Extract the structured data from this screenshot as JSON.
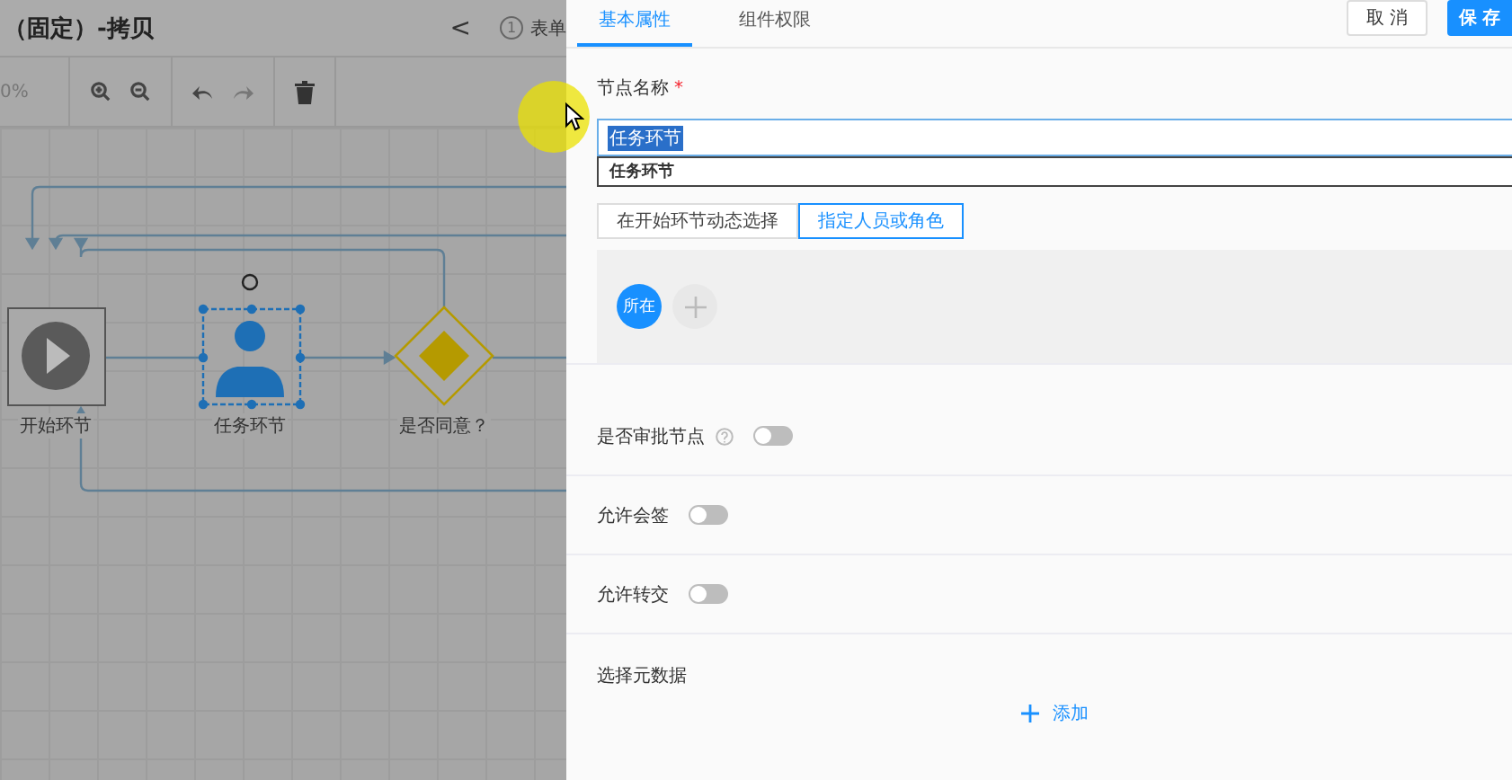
{
  "designer": {
    "title": "（固定）-拷贝",
    "back": "<",
    "step": {
      "number": "1",
      "label": "表单"
    },
    "zoom": "0%",
    "nodes": [
      {
        "kind": "start",
        "label": "开始环节",
        "selected": false
      },
      {
        "kind": "task",
        "label": "任务环节",
        "selected": true
      },
      {
        "kind": "gateway",
        "label": "是否同意？",
        "selected": false
      }
    ]
  },
  "panel": {
    "tabs": [
      {
        "label": "基本属性",
        "selected": true
      },
      {
        "label": "组件权限",
        "selected": false
      }
    ],
    "buttons": [
      {
        "label": "取 消",
        "kind": "default"
      },
      {
        "label": "保 存",
        "kind": "primary"
      }
    ],
    "name_field": {
      "label": "节点名称",
      "required_mark": "*",
      "value": "任务环节",
      "suggestion": "任务环节"
    },
    "assign_options": [
      {
        "label": "在开始环节动态选择",
        "selected": false
      },
      {
        "label": "指定人员或角色",
        "selected": true
      }
    ],
    "members": [
      {
        "label": "所在"
      }
    ],
    "switches": [
      {
        "label": "是否审批节点",
        "help": true,
        "on": false
      },
      {
        "label": "允许会签",
        "help": false,
        "on": false
      },
      {
        "label": "允许转交",
        "help": false,
        "on": false
      }
    ],
    "metadata": {
      "label": "选择元数据",
      "add": "添加"
    }
  }
}
